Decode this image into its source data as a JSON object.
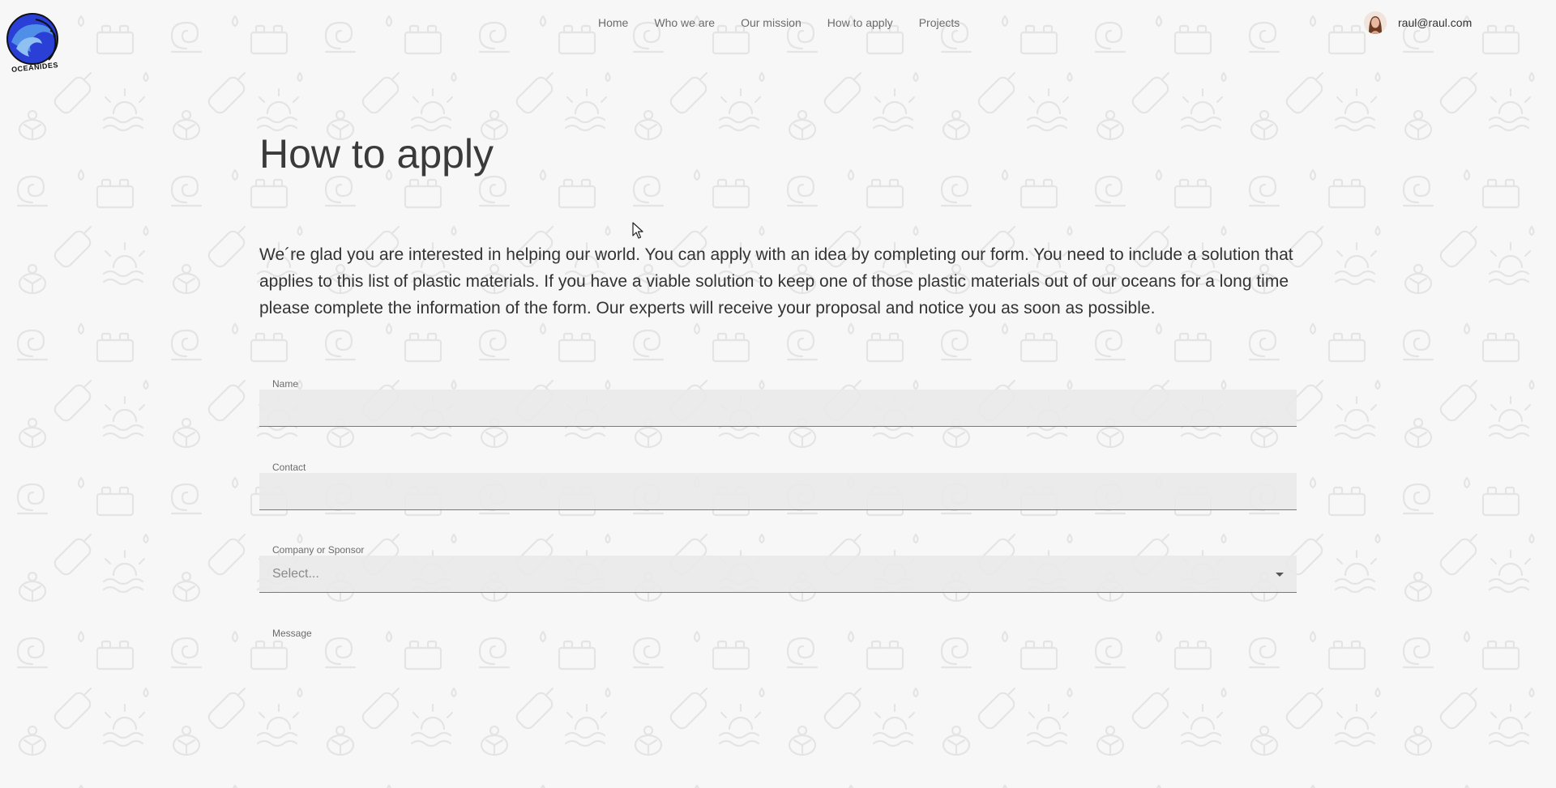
{
  "header": {
    "logo_text": "OCEANIDES",
    "nav": [
      {
        "label": "Home"
      },
      {
        "label": "Who we are"
      },
      {
        "label": "Our mission"
      },
      {
        "label": "How to apply"
      },
      {
        "label": "Projects"
      }
    ],
    "user": {
      "email": "raul@raul.com"
    }
  },
  "main": {
    "title": "How to apply",
    "intro": "We´re glad you are interested in helping our world. You can apply with an idea by completing our form. You need to include a solution that applies to this list of plastic materials. If you have a viable solution to keep one of those plastic materials out of our oceans for a long time please complete the information of the form. Our experts will receive your proposal and notice you as soon as possible."
  },
  "form": {
    "name": {
      "label": "Name",
      "value": ""
    },
    "contact": {
      "label": "Contact",
      "value": ""
    },
    "company": {
      "label": "Company or Sponsor",
      "placeholder": "Select..."
    },
    "message": {
      "label": "Message",
      "value": ""
    }
  },
  "colors": {
    "background": "#f7f7f7",
    "field_background": "#e9e9e9",
    "text": "#333333",
    "muted": "#6b6b6b",
    "logo_blue": "#2a3fd6"
  }
}
